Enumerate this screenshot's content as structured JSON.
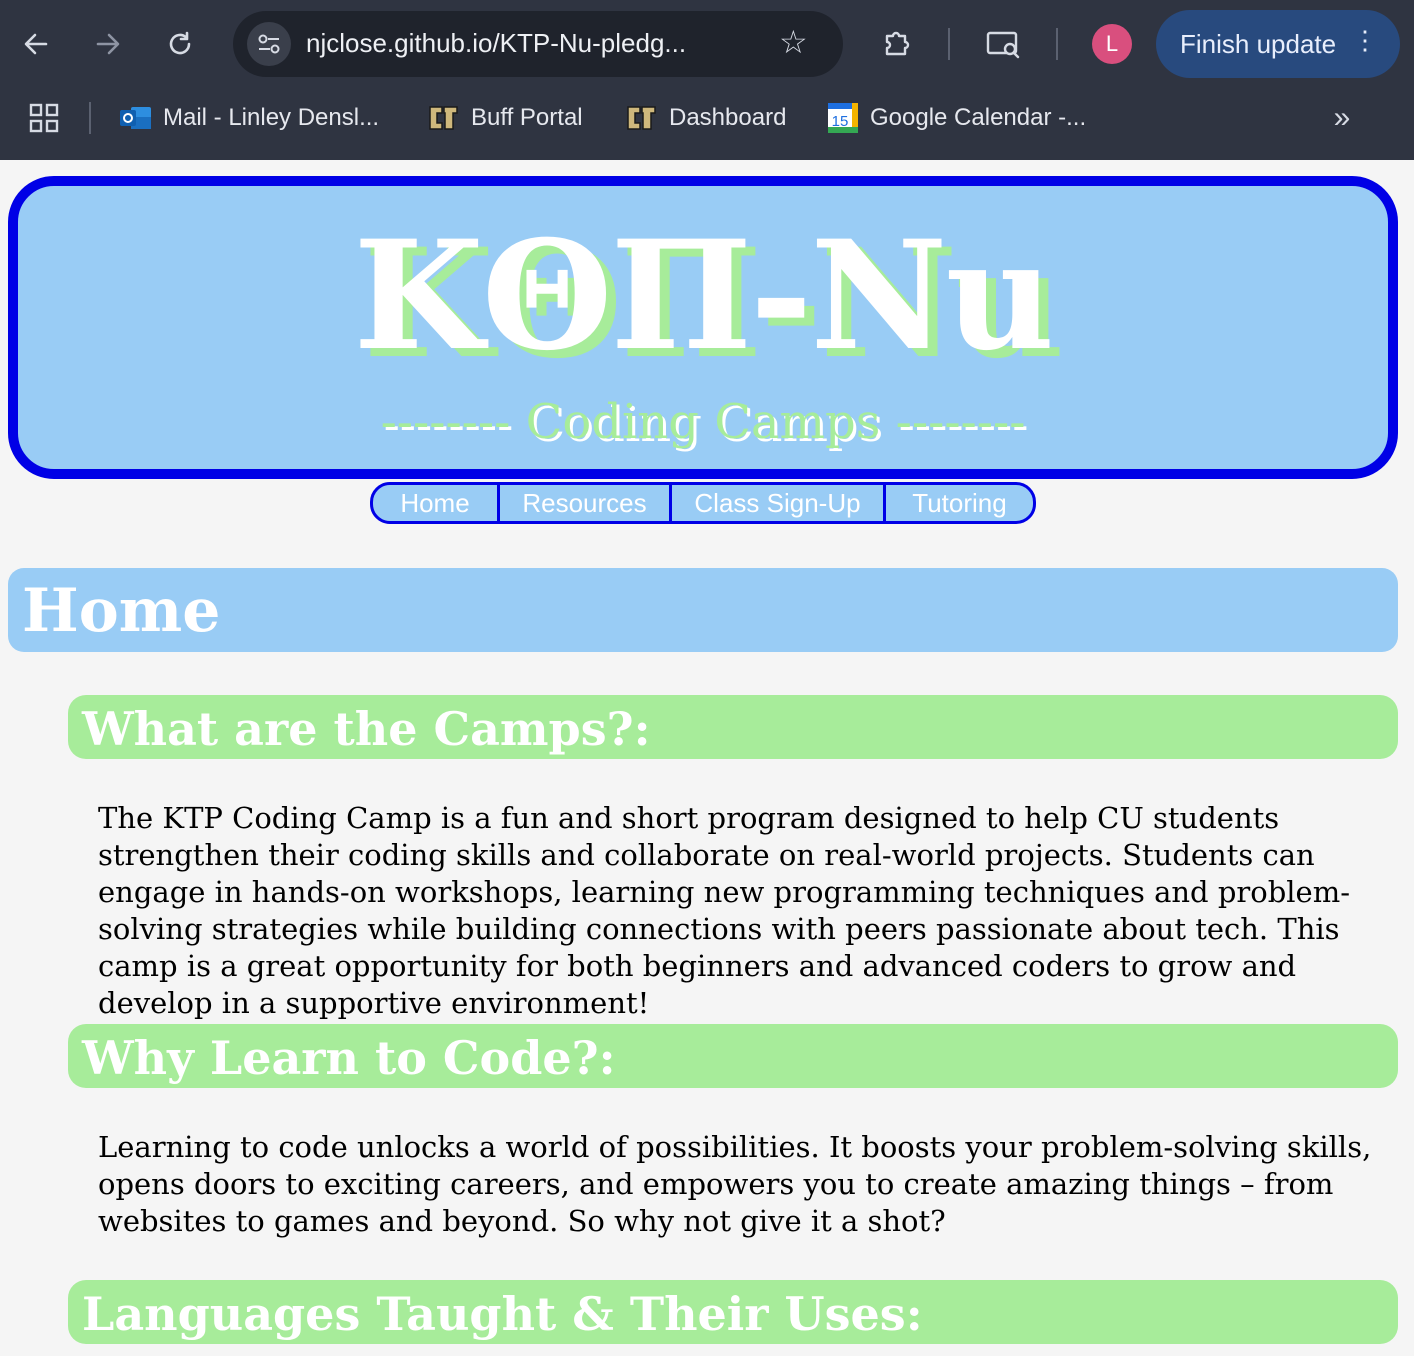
{
  "browser": {
    "back_icon": "arrow-left-icon",
    "forward_icon": "arrow-right-icon",
    "reload_icon": "reload-icon",
    "url": "njclose.github.io/KTP-Nu-pledg...",
    "avatar_letter": "L",
    "finish_update_label": "Finish update",
    "bookmarks": [
      {
        "label": "Mail - Linley Densl...",
        "icon": "outlook-icon"
      },
      {
        "label": "Buff Portal",
        "icon": "cu-logo-icon"
      },
      {
        "label": "Dashboard",
        "icon": "cu-logo-icon"
      },
      {
        "label": "Google Calendar -...",
        "icon": "calendar-icon",
        "icon_text": "15"
      }
    ],
    "more_bookmarks": "»"
  },
  "header": {
    "title": "ΚΘΠ-Nu",
    "subtitle": "-------- Coding Camps --------"
  },
  "nav": {
    "items": [
      {
        "label": "Home"
      },
      {
        "label": "Resources"
      },
      {
        "label": "Class Sign-Up"
      },
      {
        "label": "Tutoring"
      }
    ]
  },
  "main": {
    "page_title": "Home",
    "sections": [
      {
        "heading": "What are the Camps?:",
        "text": "The KTP Coding Camp is a fun and short program designed to help CU students strengthen their coding skills and collaborate on real-world projects. Students can engage in hands-on workshops, learning new programming techniques and problem-solving strategies while building connections with peers passionate about tech. This camp is a great opportunity for both beginners and advanced coders to grow and develop in a supportive environment!"
      },
      {
        "heading": "Why Learn to Code?:",
        "text": "Learning to code unlocks a world of possibilities. It boosts your problem-solving skills, opens doors to exciting careers, and empowers you to create amazing things – from websites to games and beyond. So why not give it a shot?"
      },
      {
        "heading": "Languages Taught & Their Uses:"
      }
    ]
  },
  "colors": {
    "chrome_bg": "#2f3441",
    "banner_bg": "#99ccf5",
    "banner_border": "#0000e6",
    "accent_green": "#a7ec9a",
    "page_bg": "#f5f5f5"
  }
}
